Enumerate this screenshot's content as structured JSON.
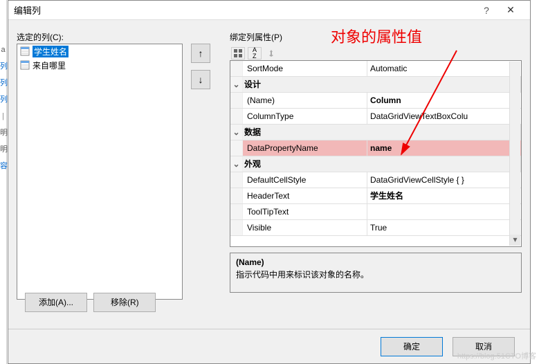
{
  "annotation": "对象的属性值",
  "title": "编辑列",
  "left_label": "选定的列(C):",
  "list_items": [
    {
      "text": "学生姓名",
      "selected": true
    },
    {
      "text": "来自哪里",
      "selected": false
    }
  ],
  "btn_add": "添加(A)...",
  "btn_remove": "移除(R)",
  "arrow_up": "↑",
  "arrow_down": "↓",
  "right_label": "绑定列属性(P)",
  "prop_rows": [
    {
      "type": "row",
      "name": "SortMode",
      "value": "Automatic"
    },
    {
      "type": "cat",
      "name": "设计"
    },
    {
      "type": "row",
      "name": "(Name)",
      "value": "Column",
      "bold": true
    },
    {
      "type": "row",
      "name": "ColumnType",
      "value": "DataGridViewTextBoxColu"
    },
    {
      "type": "cat",
      "name": "数据"
    },
    {
      "type": "row",
      "name": "DataPropertyName",
      "value": "name",
      "highlight": true
    },
    {
      "type": "cat",
      "name": "外观"
    },
    {
      "type": "row",
      "name": "DefaultCellStyle",
      "value": "DataGridViewCellStyle { }"
    },
    {
      "type": "row",
      "name": "HeaderText",
      "value": "学生姓名",
      "bold": true
    },
    {
      "type": "row",
      "name": "ToolTipText",
      "value": ""
    },
    {
      "type": "row",
      "name": "Visible",
      "value": "True"
    }
  ],
  "desc_title": "(Name)",
  "desc_text": "指示代码中用来标识该对象的名称。",
  "btn_ok": "确定",
  "btn_cancel": "取消",
  "watermark": "https://blog.51CTO博客"
}
